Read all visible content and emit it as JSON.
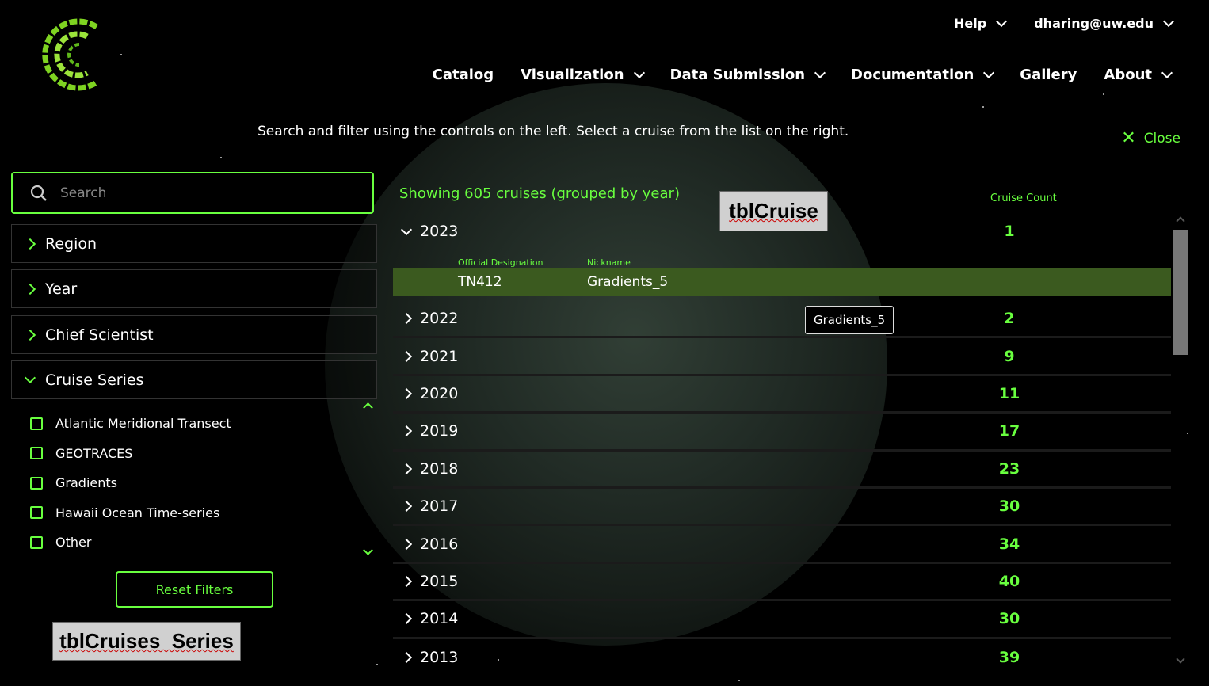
{
  "header": {
    "top_nav": [
      {
        "label": "Help",
        "has_dropdown": true
      },
      {
        "label": "dharing@uw.edu",
        "has_dropdown": true
      }
    ],
    "main_nav": [
      {
        "label": "Catalog",
        "has_dropdown": false
      },
      {
        "label": "Visualization",
        "has_dropdown": true
      },
      {
        "label": "Data Submission",
        "has_dropdown": true
      },
      {
        "label": "Documentation",
        "has_dropdown": true
      },
      {
        "label": "Gallery",
        "has_dropdown": false
      },
      {
        "label": "About",
        "has_dropdown": true
      }
    ],
    "instructions": "Search and filter using the controls on the left. Select a cruise from the list on the right.",
    "close_label": "Close"
  },
  "filters": {
    "search_placeholder": "Search",
    "sections": [
      {
        "label": "Region",
        "expanded": false
      },
      {
        "label": "Year",
        "expanded": false
      },
      {
        "label": "Chief Scientist",
        "expanded": false
      },
      {
        "label": "Cruise Series",
        "expanded": true
      }
    ],
    "cruise_series": [
      "Atlantic Meridional Transect",
      "GEOTRACES",
      "Gradients",
      "Hawaii Ocean Time-series",
      "Other"
    ],
    "reset_label": "Reset Filters"
  },
  "results": {
    "showing": "Showing 605 cruises (grouped by year)",
    "count_header": "Cruise Count",
    "col_official": "Official Designation",
    "col_nickname": "Nickname",
    "expanded_cruise": {
      "official": "TN412",
      "nickname": "Gradients_5"
    },
    "tooltip": "Gradients_5",
    "years": [
      {
        "year": "2023",
        "count": "1"
      },
      {
        "year": "2022",
        "count": "2"
      },
      {
        "year": "2021",
        "count": "9"
      },
      {
        "year": "2020",
        "count": "11"
      },
      {
        "year": "2019",
        "count": "17"
      },
      {
        "year": "2018",
        "count": "23"
      },
      {
        "year": "2017",
        "count": "30"
      },
      {
        "year": "2016",
        "count": "34"
      },
      {
        "year": "2015",
        "count": "40"
      },
      {
        "year": "2014",
        "count": "30"
      },
      {
        "year": "2013",
        "count": "39"
      }
    ]
  },
  "annotations": {
    "table_cruise": "tblCruise",
    "table_series": "tblCruises_Series"
  },
  "colors": {
    "accent": "#69ff3f",
    "selected_row": "#3b5a1f",
    "background": "#000000"
  }
}
